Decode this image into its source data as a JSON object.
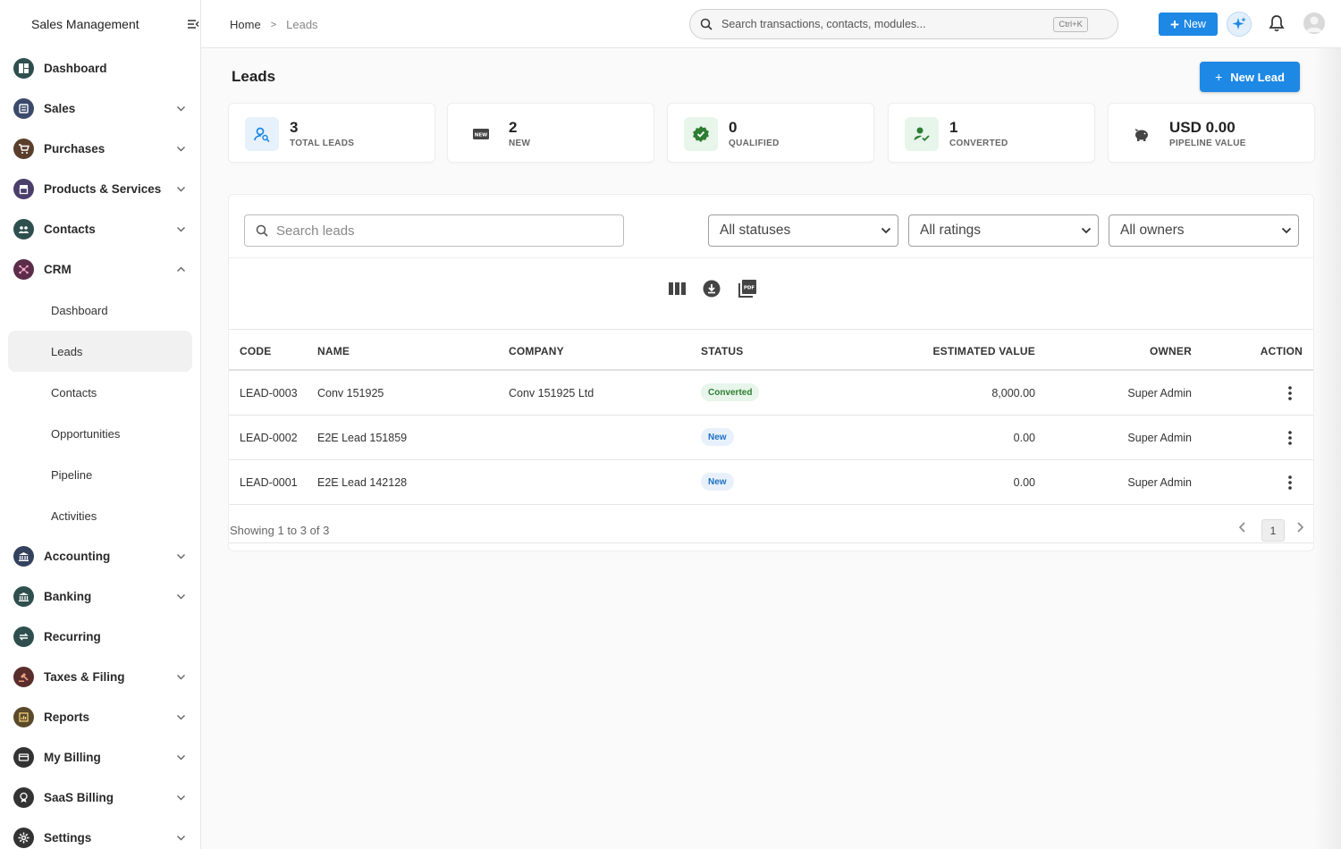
{
  "app": {
    "title": "Sales Management"
  },
  "sidebar": {
    "items": [
      {
        "label": "Dashboard",
        "icon": "dashboard-icon",
        "color": "#2f4f4f",
        "expandable": false
      },
      {
        "label": "Sales",
        "icon": "sales-icon",
        "color": "#3b4a6b",
        "expandable": true
      },
      {
        "label": "Purchases",
        "icon": "cart-icon",
        "color": "#5a3e2b",
        "expandable": true
      },
      {
        "label": "Products & Services",
        "icon": "box-icon",
        "color": "#4a3f6b",
        "expandable": true
      },
      {
        "label": "Contacts",
        "icon": "people-icon",
        "color": "#2f4f4f",
        "expandable": true
      },
      {
        "label": "CRM",
        "icon": "crm-icon",
        "color": "#5b2d4a",
        "expandable": true,
        "expanded": true
      }
    ],
    "crm_sub": [
      {
        "label": "Dashboard",
        "active": false
      },
      {
        "label": "Leads",
        "active": true
      },
      {
        "label": "Contacts",
        "active": false
      },
      {
        "label": "Opportunities",
        "active": false
      },
      {
        "label": "Pipeline",
        "active": false
      },
      {
        "label": "Activities",
        "active": false
      }
    ],
    "items_after": [
      {
        "label": "Accounting",
        "icon": "bank-icon",
        "color": "#34425e",
        "expandable": true
      },
      {
        "label": "Banking",
        "icon": "bank-building-icon",
        "color": "#2f4f4f",
        "expandable": true
      },
      {
        "label": "Recurring",
        "icon": "repeat-icon",
        "color": "#2f4f4f",
        "expandable": false
      },
      {
        "label": "Taxes & Filing",
        "icon": "gavel-icon",
        "color": "#5a2d2d",
        "expandable": true
      },
      {
        "label": "Reports",
        "icon": "report-icon",
        "color": "#5a4a2b",
        "expandable": true
      },
      {
        "label": "My Billing",
        "icon": "billing-icon",
        "color": "#333333",
        "expandable": true
      },
      {
        "label": "SaaS Billing",
        "icon": "badge-icon",
        "color": "#333333",
        "expandable": true
      },
      {
        "label": "Settings",
        "icon": "gear-icon",
        "color": "#333333",
        "expandable": true
      }
    ]
  },
  "topbar": {
    "breadcrumb": {
      "home": "Home",
      "separator": ">",
      "current": "Leads"
    },
    "search": {
      "placeholder": "Search transactions, contacts, modules...",
      "shortcut": "Ctrl+K"
    },
    "new_label": "New"
  },
  "page": {
    "title": "Leads",
    "new_lead_label": "New Lead"
  },
  "stats": [
    {
      "value": "3",
      "label": "TOTAL LEADS",
      "icon": "user-search-icon",
      "bg": "#e6f1fb",
      "fg": "#1e88e5"
    },
    {
      "value": "2",
      "label": "NEW",
      "icon": "new-badge-icon",
      "bg": "#ffffff",
      "fg": "#444444"
    },
    {
      "value": "0",
      "label": "QUALIFIED",
      "icon": "verified-icon",
      "bg": "#e7f5ea",
      "fg": "#2e7d32"
    },
    {
      "value": "1",
      "label": "CONVERTED",
      "icon": "user-check-icon",
      "bg": "#e7f5ea",
      "fg": "#2e7d32"
    },
    {
      "value": "USD 0.00",
      "label": "PIPELINE VALUE",
      "icon": "piggy-bank-icon",
      "bg": "#ffffff",
      "fg": "#444444"
    }
  ],
  "filters": {
    "search_placeholder": "Search leads",
    "status": "All statuses",
    "rating": "All ratings",
    "owner": "All owners"
  },
  "table": {
    "columns": [
      "CODE",
      "NAME",
      "COMPANY",
      "STATUS",
      "ESTIMATED VALUE",
      "OWNER",
      "ACTION"
    ],
    "rows": [
      {
        "code": "LEAD-0003",
        "name": "Conv 151925",
        "company": "Conv 151925 Ltd",
        "status": "Converted",
        "status_kind": "converted",
        "value": "8,000.00",
        "owner": "Super Admin"
      },
      {
        "code": "LEAD-0002",
        "name": "E2E Lead 151859",
        "company": "",
        "status": "New",
        "status_kind": "new",
        "value": "0.00",
        "owner": "Super Admin"
      },
      {
        "code": "LEAD-0001",
        "name": "E2E Lead 142128",
        "company": "",
        "status": "New",
        "status_kind": "new",
        "value": "0.00",
        "owner": "Super Admin"
      }
    ],
    "showing": "Showing 1 to 3 of 3",
    "page": "1"
  },
  "colors": {
    "accent": "#1e88e5",
    "converted": "#2e7d32",
    "new": "#1e6fc2"
  }
}
